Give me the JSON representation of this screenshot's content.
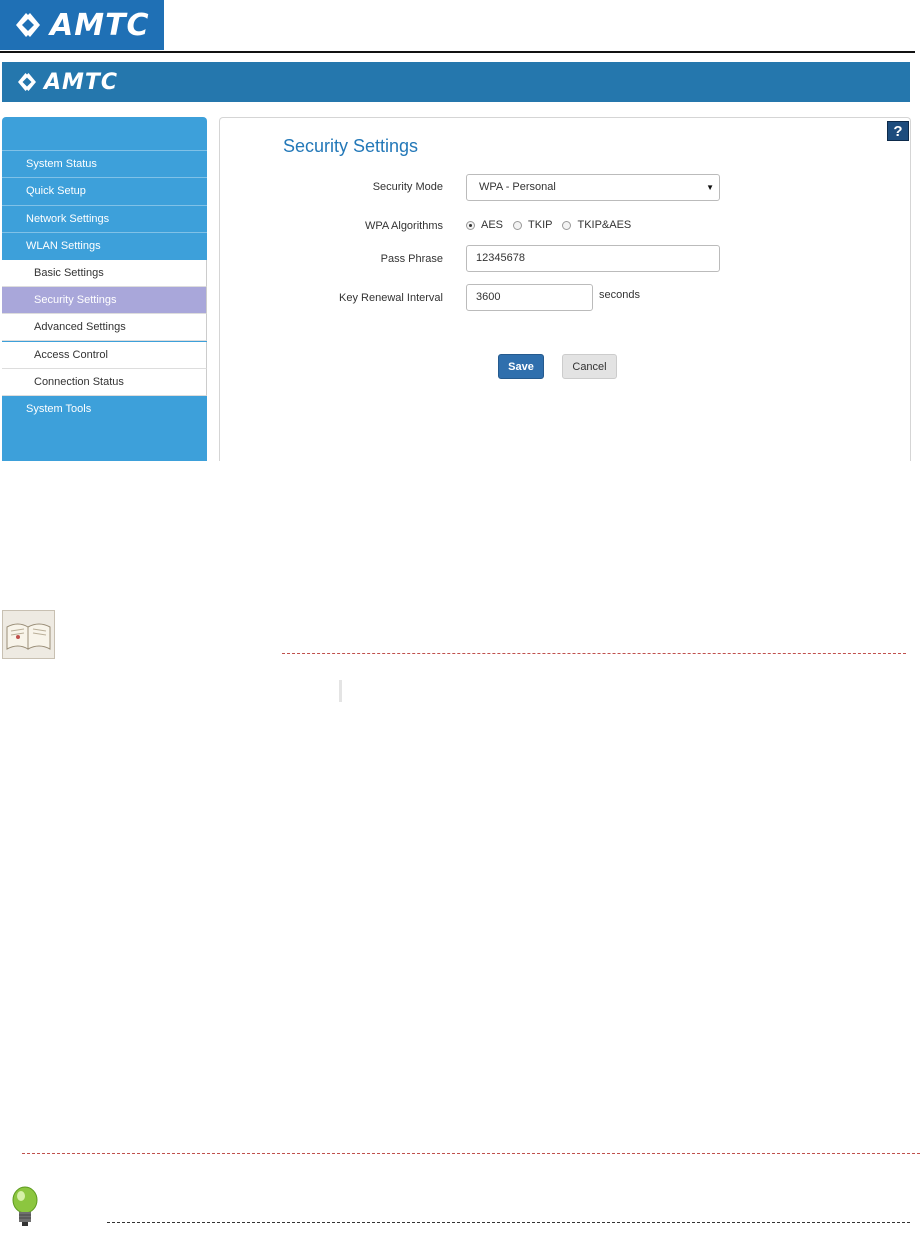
{
  "brand": {
    "logo_text": "AMTC",
    "doc_logo_color": "#1f70b5",
    "banner_color": "#2577ad"
  },
  "sidebar": {
    "items": [
      {
        "label": "System Status"
      },
      {
        "label": "Quick Setup"
      },
      {
        "label": "Network Settings"
      },
      {
        "label": "WLAN Settings"
      }
    ],
    "sub_items": [
      {
        "label": "Basic Settings"
      },
      {
        "label": "Security Settings"
      },
      {
        "label": "Advanced Settings"
      },
      {
        "label": "Access Control"
      },
      {
        "label": "Connection Status"
      }
    ],
    "footer_item": {
      "label": "System Tools"
    },
    "active_item": "Security Settings",
    "accent_color": "#3da0da",
    "active_color": "#a9a7da"
  },
  "main": {
    "help_icon": "?",
    "title": "Security Settings",
    "security_mode": {
      "label": "Security Mode",
      "value": "WPA - Personal"
    },
    "wpa_algorithms": {
      "label": "WPA Algorithms",
      "options": [
        "AES",
        "TKIP",
        "TKIP&AES"
      ],
      "selected": "AES"
    },
    "pass_phrase": {
      "label": "Pass Phrase",
      "value": "12345678"
    },
    "key_renewal": {
      "label": "Key Renewal Interval",
      "value": "3600",
      "unit": "seconds"
    },
    "save_label": "Save",
    "cancel_label": "Cancel"
  },
  "doc": {
    "book_icon": "book-icon",
    "bulb_icon": "lightbulb-icon",
    "note_rule_color": "#c0504d"
  }
}
